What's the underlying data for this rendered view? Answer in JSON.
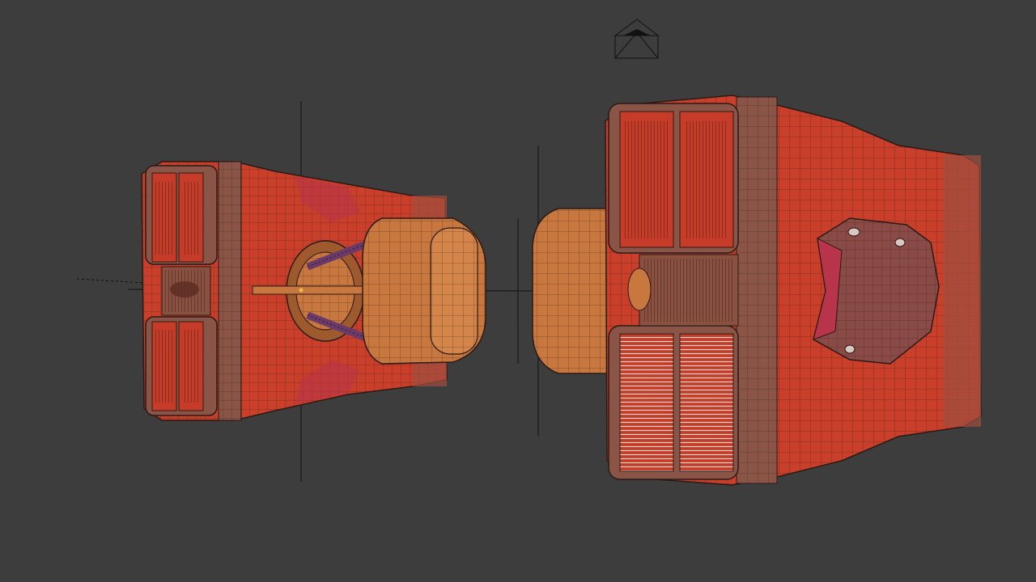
{
  "viewport": {
    "background": "#3d3d3d",
    "object_names": [
      "engine-pod-left",
      "engine-pod-right"
    ]
  },
  "colors": {
    "body_red": "#c93f2a",
    "body_dark": "#a53222",
    "rim_brown": "#8a5547",
    "rim_dark": "#6a3a30",
    "nozzle_orange": "#c8773f",
    "nozzle_dark": "#9e5a2d",
    "highlight_pink": "#b8344a",
    "wire": "#2a1a16",
    "grille_light": "#d8c8c0",
    "strut_purple": "#6a3a6a",
    "axis_line": "#111111",
    "camera_gizmo": "#111111"
  },
  "icons": {
    "camera": "camera-gizmo-icon"
  }
}
